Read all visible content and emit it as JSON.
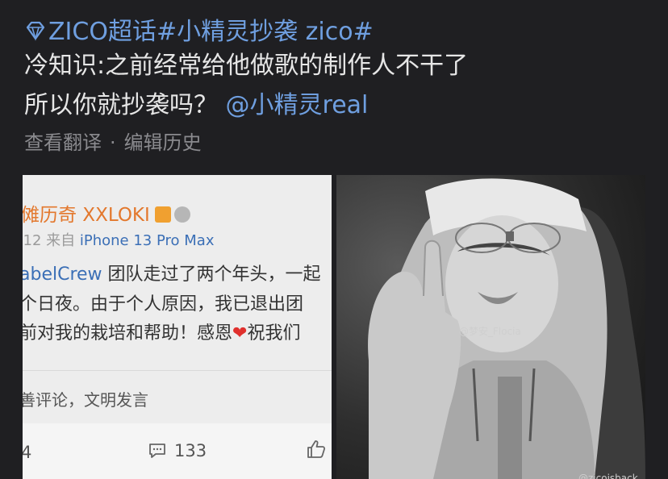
{
  "post": {
    "topic_link": "ZICO超话#小精灵抄袭 zico#",
    "line2": "冷知识:之前经常给他做歌的制作人不干了",
    "line3_text": "所以你就抄袭吗？",
    "line3_mention": "@小精灵real",
    "translate_label": "查看翻译",
    "separator": "·",
    "edit_history_label": "编辑历史"
  },
  "left_image": {
    "user_name": "傩历奇 XXLOKI",
    "date_fragment": "-12",
    "source_label": "来自",
    "device": "iPhone 13 Pro Max",
    "body_line1_blue": "abelCrew",
    "body_line1_text": " 团队走过了两个年头，一起",
    "body_line2": "个日夜。由于个人原因，我已退出团",
    "body_line3_text": "前对我的栽培和帮助！感恩",
    "body_line3_heart": "❤",
    "body_line3_end": "祝我们",
    "comment_placeholder": "善评论，文明发言",
    "count_left": "4",
    "comment_count": "133"
  },
  "right_image": {
    "watermark1": "@梦安_Flocia",
    "watermark2": "@zicoisback"
  },
  "colors": {
    "background": "#1f1f22",
    "link": "#6f9fe0",
    "text": "#e6e6e6",
    "meta": "#8a8a8e"
  }
}
